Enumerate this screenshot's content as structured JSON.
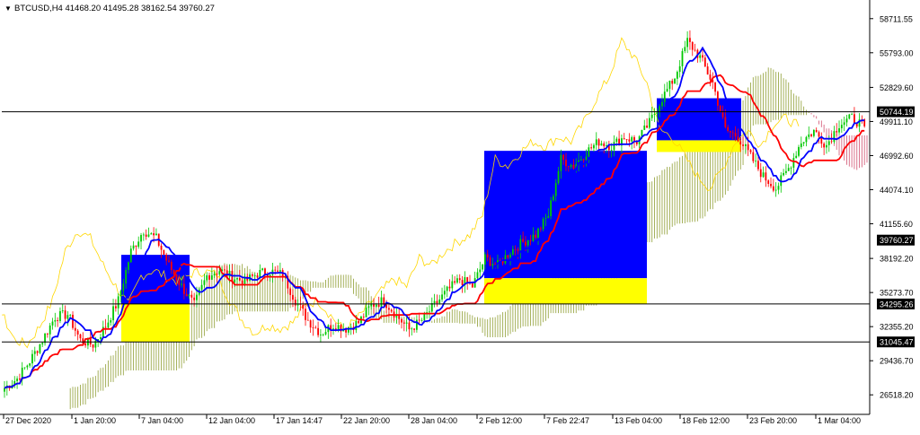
{
  "symbol_header": {
    "text": "BTCUSD,H4  41468.20 41495.28 38162.54 39760.27",
    "menu_glyph": "▼"
  },
  "chart_data": {
    "type": "candlestick",
    "symbol": "BTCUSD",
    "timeframe": "H4",
    "ohlc_current": {
      "open": 41468.2,
      "high": 41495.28,
      "low": 38162.54,
      "close": 39760.27
    },
    "ylim": [
      25000,
      60000
    ],
    "y_ticks": [
      58711.55,
      55793.0,
      52829.6,
      49911.1,
      46992.6,
      44074.1,
      41155.6,
      38192.2,
      35273.7,
      32355.2,
      29436.7,
      26518.2
    ],
    "x_ticks": [
      "27 Dec 2020",
      "1 Jan 20:00",
      "7 Jan 04:00",
      "12 Jan 04:00",
      "17 Jan 14:47",
      "22 Jan 20:00",
      "28 Jan 04:00",
      "2 Feb 12:00",
      "7 Feb 22:47",
      "13 Feb 04:00",
      "18 Feb 12:00",
      "23 Feb 20:00",
      "1 Mar 04:00"
    ],
    "horizontal_lines": [
      {
        "price": 50744.19,
        "label": "50744.19"
      },
      {
        "price": 34295.26,
        "label": "34295.26"
      },
      {
        "price": 31045.47,
        "label": "31045.47"
      }
    ],
    "price_label": {
      "price": 39760.27,
      "label": "39760.27"
    },
    "close_series": [
      27100,
      27900,
      29400,
      31200,
      33200,
      33400,
      31200,
      30800,
      32400,
      34600,
      38800,
      40600,
      39900,
      37600,
      35800,
      34200,
      36700,
      37200,
      36600,
      36200,
      36900,
      37100,
      36800,
      34600,
      32900,
      31800,
      32500,
      32200,
      32700,
      34200,
      34600,
      33300,
      32100,
      32900,
      34200,
      35400,
      36400,
      35800,
      38200,
      37600,
      38800,
      39600,
      40200,
      41900,
      46700,
      46100,
      47300,
      48200,
      47800,
      48600,
      48200,
      49800,
      51900,
      53700,
      56800,
      55400,
      53200,
      49200,
      48600,
      46900,
      45200,
      44200,
      45900,
      48200,
      49100,
      47900,
      49700,
      50200,
      49500
    ]
  },
  "ichimoku": {
    "tenkan_color": "#0000ff",
    "kijun_color": "#ff0000",
    "chikou_color": "#ffd700",
    "bull_cloud_color": "#8a9a2a",
    "bear_cloud_color": "#d04a6a"
  },
  "zones": [
    {
      "name": "jan-zone",
      "top_price": 38500,
      "split_price": 34295.26,
      "bottom_price": 31045.47
    },
    {
      "name": "feb-zone",
      "top_price": 47400,
      "split_price": 36500,
      "bottom_price": 34295.26
    },
    {
      "name": "feb-late-zone",
      "top_price": 51900,
      "split_price": 48300,
      "bottom_price": 47300
    }
  ],
  "colors": {
    "bull_candle": "#00c800",
    "bear_candle": "#ff0000",
    "zone_upper": "#0000ff",
    "zone_lower": "#ffff00",
    "line": "#000000",
    "axis_text": "#000000",
    "label_bg": "#000000",
    "label_text": "#ffffff"
  }
}
